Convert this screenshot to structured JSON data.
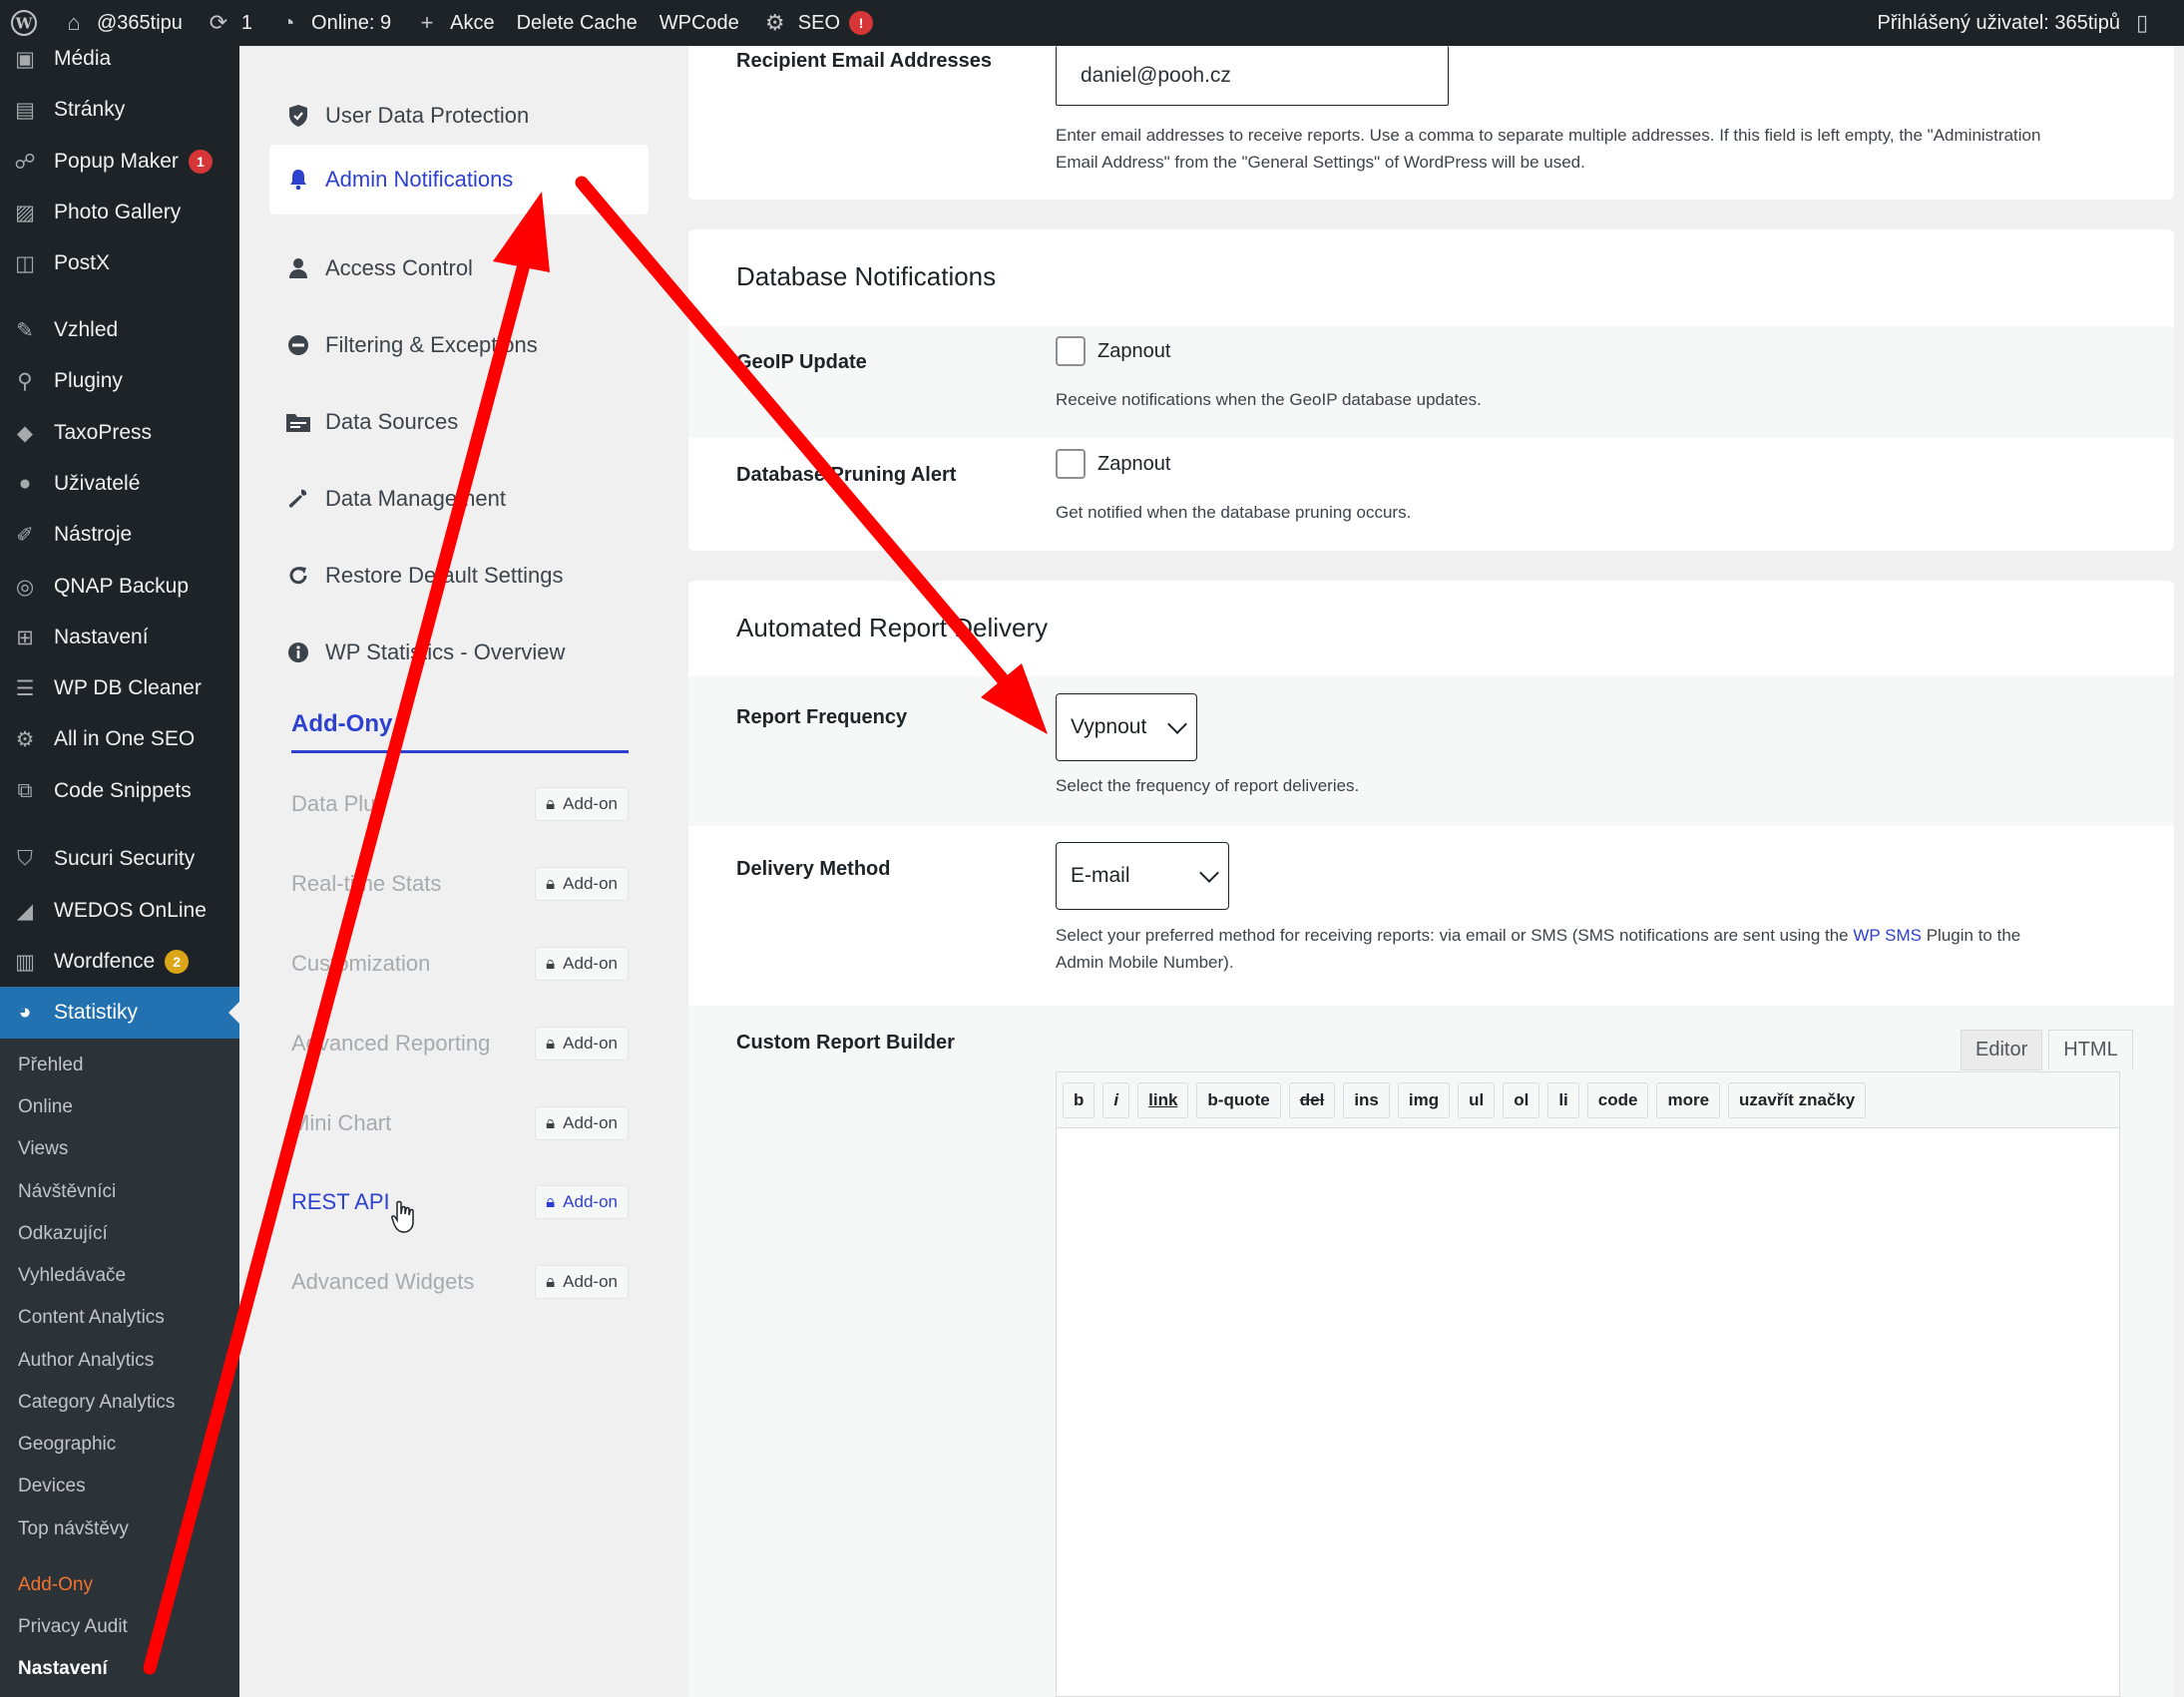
{
  "admin_bar": {
    "site": "@365tipu",
    "updates": "1",
    "online": "Online: 9",
    "new": "Akce",
    "delete_cache": "Delete Cache",
    "wpcode": "WPCode",
    "seo": "SEO",
    "seo_badge": "!",
    "user": "Přihlášený uživatel: 365tipů"
  },
  "admin_menu": {
    "items": [
      {
        "label": "Média",
        "icon": "media-icon"
      },
      {
        "label": "Stránky",
        "icon": "pages-icon"
      },
      {
        "label": "Popup Maker",
        "icon": "popup-icon",
        "badge": "1"
      },
      {
        "label": "Photo Gallery",
        "icon": "gallery-icon"
      },
      {
        "label": "PostX",
        "icon": "postx-icon"
      },
      {
        "label": "Vzhled",
        "icon": "appearance-icon"
      },
      {
        "label": "Pluginy",
        "icon": "plugins-icon"
      },
      {
        "label": "TaxoPress",
        "icon": "tag-icon"
      },
      {
        "label": "Uživatelé",
        "icon": "users-icon"
      },
      {
        "label": "Nástroje",
        "icon": "tools-icon"
      },
      {
        "label": "QNAP Backup",
        "icon": "backup-icon"
      },
      {
        "label": "Nastavení",
        "icon": "settings-icon"
      },
      {
        "label": "WP DB Cleaner",
        "icon": "database-icon"
      },
      {
        "label": "All in One SEO",
        "icon": "seo-icon"
      },
      {
        "label": "Code Snippets",
        "icon": "code-icon"
      },
      {
        "label": "Sucuri Security",
        "icon": "shield-icon"
      },
      {
        "label": "WEDOS OnLine",
        "icon": "chart-icon"
      },
      {
        "label": "Wordfence",
        "icon": "wordfence-icon",
        "badge": "2"
      },
      {
        "label": "Statistiky",
        "icon": "pie-chart-icon"
      }
    ],
    "submenu": [
      "Přehled",
      "Online",
      "Views",
      "Návštěvníci",
      "Odkazující",
      "Vyhledávače",
      "Content Analytics",
      "Author Analytics",
      "Category Analytics",
      "Geographic",
      "Devices",
      "Top návštěvy",
      "Add-Ony",
      "Privacy Audit",
      "Nastavení"
    ]
  },
  "settings_nav": {
    "items": [
      "User Data Protection",
      "Admin Notifications",
      "Access Control",
      "Filtering & Exceptions",
      "Data Sources",
      "Data Management",
      "Restore Default Settings",
      "WP Statistics - Overview"
    ],
    "addons_heading": "Add-Ony",
    "addons": [
      "Data Plus",
      "Real-time Stats",
      "Customization",
      "Advanced Reporting",
      "Mini Chart",
      "REST API",
      "Advanced Widgets"
    ],
    "addon_badge": "Add-on"
  },
  "recipient": {
    "label": "Recipient Email Addresses",
    "value": "daniel@pooh.cz",
    "desc_line1": "Enter email addresses to receive reports. Use a comma to separate multiple addresses. If this field is left empty, the \"Administration",
    "desc_line2": "Email Address\" from the \"General Settings\" of WordPress will be used."
  },
  "db_notifications": {
    "title": "Database Notifications",
    "geoip_label": "GeoIP Update",
    "geoip_check": "Zapnout",
    "geoip_desc": "Receive notifications when the GeoIP database updates.",
    "pruning_label": "Database Pruning Alert",
    "pruning_check": "Zapnout",
    "pruning_desc": "Get notified when the database pruning occurs."
  },
  "report_delivery": {
    "title": "Automated Report Delivery",
    "freq_label": "Report Frequency",
    "freq_value": "Vypnout",
    "freq_desc": "Select the frequency of report deliveries.",
    "method_label": "Delivery Method",
    "method_value": "E-mail",
    "method_desc_pre": "Select your preferred method for receiving reports: via email or SMS (SMS notifications are sent using the ",
    "method_desc_link": "WP SMS",
    "method_desc_post": " Plugin to the",
    "method_desc_line2": "Admin Mobile Number).",
    "builder_label": "Custom Report Builder",
    "tab_editor": "Editor",
    "tab_html": "HTML",
    "quicktags": [
      "b",
      "i",
      "link",
      "b-quote",
      "del",
      "ins",
      "img",
      "ul",
      "ol",
      "li",
      "code",
      "more",
      "uzavřít značky"
    ]
  },
  "colors": {
    "accent": "#2d41d0",
    "admin_dark": "#1d2327",
    "wp_blue": "#2271b1",
    "arrow": "#ff0000"
  }
}
